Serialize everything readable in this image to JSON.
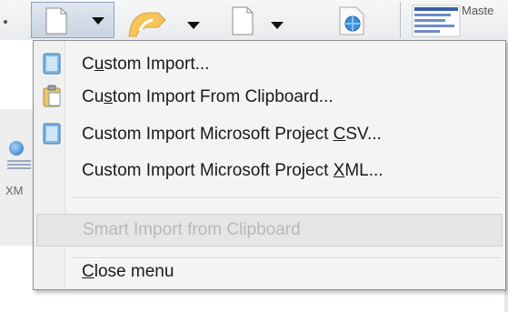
{
  "toolbar": {
    "master_label": "Maste",
    "buttons": [
      {
        "name": "import-button",
        "icon": "document-icon"
      },
      {
        "name": "export-button",
        "icon": "chart-export-icon"
      },
      {
        "name": "print-button",
        "icon": "document-icon"
      },
      {
        "name": "web-button",
        "icon": "globe-icon"
      }
    ]
  },
  "side_label": "XM",
  "menu": {
    "items": [
      {
        "pre": "C",
        "acc": "u",
        "post": "stom Import...",
        "icon": "import-icon"
      },
      {
        "pre": "Cu",
        "acc": "s",
        "post": "tom Import From Clipboard...",
        "icon": "clipboard-icon"
      },
      {
        "pre": "Custom Import Microsoft Project ",
        "acc": "C",
        "post": "SV...",
        "icon": "import-icon"
      },
      {
        "pre": "Custom Import Microsoft Project ",
        "acc": "X",
        "post": "ML...",
        "icon": ""
      }
    ],
    "smart_import": "Smart Import from Clipboard",
    "close": {
      "pre": "",
      "acc": "C",
      "post": "lose menu"
    }
  },
  "colors": {
    "menu_bg": "#f4f4f4",
    "menu_border": "#8e8f8f",
    "disabled_text": "#b8b8b8",
    "icon_blue": "#5ea0d8"
  }
}
